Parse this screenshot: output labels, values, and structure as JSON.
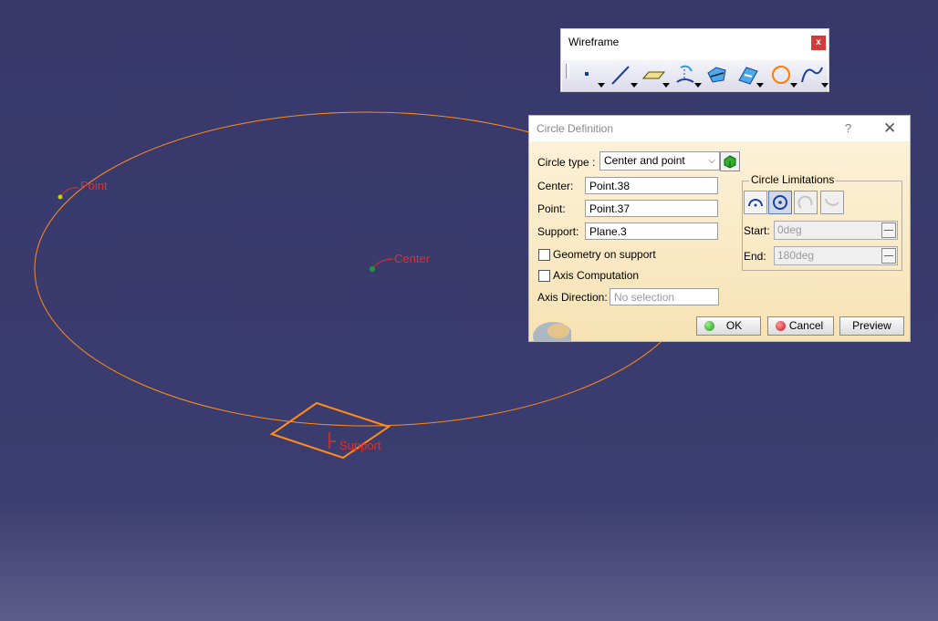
{
  "viewport": {
    "labels": {
      "point": "Point",
      "center": "Center",
      "support": "Support"
    },
    "colors": {
      "geometry": "#ff8c1a",
      "label": "#e0302a",
      "background": "#38386b"
    }
  },
  "toolbar": {
    "title": "Wireframe",
    "close_label": "x",
    "icons": [
      "point-icon",
      "line-icon",
      "plane-icon",
      "projection-icon",
      "intersection-icon",
      "parallel-curve-icon",
      "circle-icon",
      "spline-icon"
    ]
  },
  "dialog": {
    "title": "Circle Definition",
    "help": "?",
    "close": "✕",
    "circle_type_label": "Circle type :",
    "circle_type_value": "Center and point",
    "center_label": "Center:",
    "center_value": "Point.38",
    "point_label": "Point:",
    "point_value": "Point.37",
    "support_label": "Support:",
    "support_value": "Plane.3",
    "geometry_on_support_label": "Geometry on support",
    "axis_computation_label": "Axis Computation",
    "axis_direction_label": "Axis Direction:",
    "axis_direction_value": "No selection",
    "limitations": {
      "legend": "Circle Limitations",
      "start_label": "Start:",
      "start_value": "0deg",
      "end_label": "End:",
      "end_value": "180deg"
    },
    "buttons": {
      "ok": "OK",
      "cancel": "Cancel",
      "preview": "Preview"
    }
  }
}
